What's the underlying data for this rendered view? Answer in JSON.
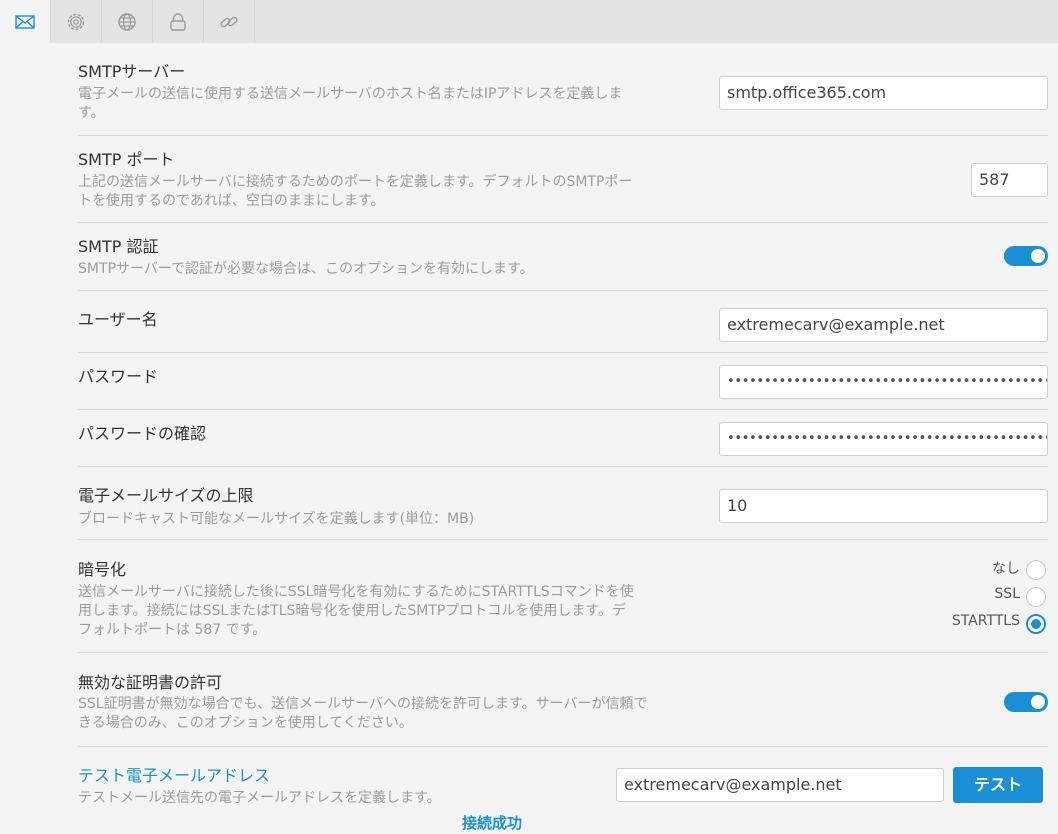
{
  "tabs": [
    {
      "icon": "mail-icon",
      "active": true
    },
    {
      "icon": "gear-icon",
      "active": false
    },
    {
      "icon": "globe-icon",
      "active": false
    },
    {
      "icon": "lock-icon",
      "active": false
    },
    {
      "icon": "link-icon",
      "active": false
    }
  ],
  "smtp_server": {
    "title": "SMTPサーバー",
    "desc": "電子メールの送信に使用する送信メールサーバのホスト名またはIPアドレスを定義します。",
    "value": "smtp.office365.com"
  },
  "smtp_port": {
    "title": "SMTP ポート",
    "desc": "上記の送信メールサーバに接続するためのポートを定義します。デフォルトのSMTPポートを使用するのであれば、空白のままにします。",
    "value": "587"
  },
  "smtp_auth": {
    "title": "SMTP 認証",
    "desc": "SMTPサーバーで認証が必要な場合は、このオプションを有効にします。",
    "enabled": true
  },
  "username": {
    "title": "ユーザー名",
    "value": "extremecarv@example.net"
  },
  "password": {
    "title": "パスワード",
    "value": "••••••••••••••••••••••••••••••••••••••••••••••••••"
  },
  "password_confirm": {
    "title": "パスワードの確認",
    "value": "••••••••••••••••••••••••••••••••••••••••••••••••••"
  },
  "max_size": {
    "title": "電子メールサイズの上限",
    "desc": "ブロードキャスト可能なメールサイズを定義します(単位：MB)",
    "value": "10"
  },
  "encryption": {
    "title": "暗号化",
    "desc": "送信メールサーバに接続した後にSSL暗号化を有効にするためにSTARTTLSコマンドを使用します。接続にはSSLまたはTLS暗号化を使用したSMTPプロトコルを使用します。デフォルトポートは 587 です。",
    "options": [
      "なし",
      "SSL",
      "STARTTLS"
    ],
    "selected": "STARTTLS"
  },
  "invalid_cert": {
    "title": "無効な証明書の許可",
    "desc": "SSL証明書が無効な場合でも、送信メールサーバへの接続を許可します。サーバーが信頼できる場合のみ、このオプションを使用してください。",
    "enabled": true
  },
  "test_email": {
    "title": "テスト電子メールアドレス",
    "desc": "テストメール送信先の電子メールアドレスを定義します。",
    "value": "extremecarv@example.net",
    "button": "テスト",
    "status": "接続成功"
  },
  "colors": {
    "accent": "#1a8fd6",
    "background": "#f4f4f4",
    "tabbar": "#e4e4e4"
  }
}
